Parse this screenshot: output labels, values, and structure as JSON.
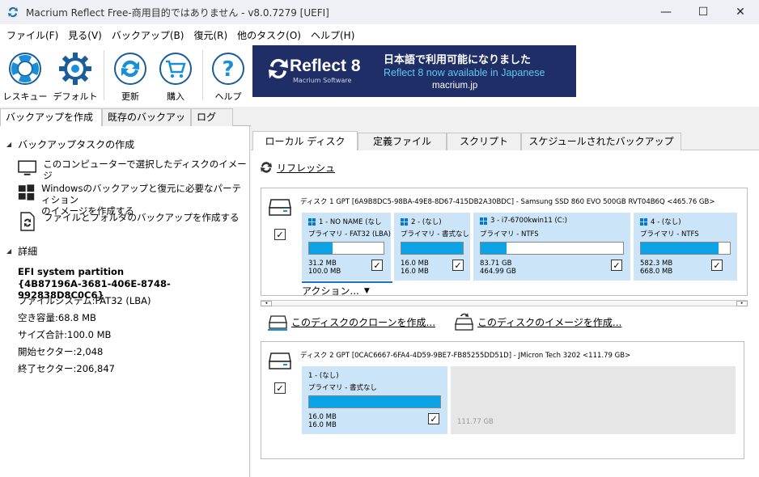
{
  "window": {
    "title": "Macrium Reflect Free-商用目的ではありません - v8.0.7279  [UEFI]",
    "minimize": "—",
    "maximize": "☐",
    "close": "✕"
  },
  "menu": [
    "ファイル(F)",
    "見る(V)",
    "バックアップ(B)",
    "復元(R)",
    "他のタスク(O)",
    "ヘルプ(H)"
  ],
  "toolbar": {
    "rescue": "レスキュー",
    "default": "デフォルト",
    "update": "更新",
    "buy": "購入",
    "help": "ヘルプ"
  },
  "banner": {
    "brand": "Reflect 8",
    "sub": "Macrium Software",
    "jp": "日本語で利用可能になりました",
    "en": "Reflect 8 now available in Japanese",
    "url": "macrium.jp"
  },
  "left_tabs": [
    "バックアップを作成する",
    "既存のバックアップ",
    "ログ"
  ],
  "tasks": {
    "header": "バックアップタスクの作成",
    "items": [
      {
        "l1": "このコンピューターで選択したディスクのイメージ",
        "l2": ""
      },
      {
        "l1": "Windowsのバックアップと復元に必要なパーティション",
        "l2": "のイメージを作成する"
      },
      {
        "l1": "ファイルとフォルダのバックアップを作成する",
        "l2": ""
      }
    ]
  },
  "details": {
    "header": "詳細",
    "name": "EFI system partition",
    "guid": "{4B87196A-3681-406E-8748-992838D8C0C6}",
    "fs": "ファイルシステム:FAT32 (LBA)",
    "free": "空き容量:68.8 MB",
    "size": "サイズ合計:100.0 MB",
    "start": "開始セクター:2,048",
    "end": "終了セクター:206,847"
  },
  "right_tabs": [
    "ローカル ディスク",
    "定義ファイル",
    "スクリプト",
    "スケジュールされたバックアップ"
  ],
  "refresh": "リフレッシュ",
  "disk1": {
    "header": "ディスク 1 GPT [6A9B8DC5-98BA-49E8-8D67-415DB2A30BDC] - Samsung SSD 860 EVO 500GB RVT04B6Q  <465.76 GB>",
    "partitions": [
      {
        "name": "1 - NO NAME (なし",
        "type": "プライマリ - FAT32 (LBA)",
        "used": "31.2 MB",
        "total": "100.0 MB",
        "fill": 0.31
      },
      {
        "name": "2 -  (なし)",
        "type": "プライマリ - 書式なし",
        "used": "16.0 MB",
        "total": "16.0 MB",
        "fill": 1.0
      },
      {
        "name": "3 - i7-6700kwin11 (C:)",
        "type": "プライマリ - NTFS",
        "used": "83.71 GB",
        "total": "464.99 GB",
        "fill": 0.18
      },
      {
        "name": "4 -  (なし)",
        "type": "プライマリ - NTFS",
        "used": "582.3 MB",
        "total": "668.0 MB",
        "fill": 0.87
      }
    ],
    "actions": "アクション...",
    "clone": "このディスクのクローンを作成...",
    "image": "このディスクのイメージを作成..."
  },
  "disk2": {
    "header": "ディスク 2 GPT [0CAC6667-6FA4-4D59-9BE7-FB85255DD51D] - JMicron  Tech             3202  <111.79 GB>",
    "partition": {
      "name": "1 -  (なし)",
      "type": "プライマリ - 書式なし",
      "used": "16.0 MB",
      "total": "16.0 MB",
      "fill": 1.0
    },
    "unallocated": "111.77 GB"
  },
  "check_mark": "✓",
  "colors": {
    "accent": "#0ba3e6",
    "partition_bg": "#cce4f7",
    "banner_bg": "#1f2e66"
  }
}
